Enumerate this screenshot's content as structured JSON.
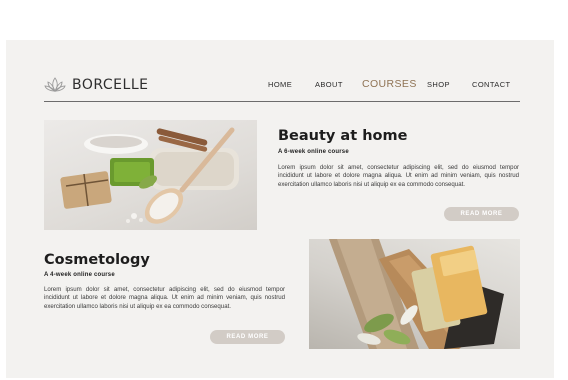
{
  "brand": {
    "name": "BORCELLE",
    "icon": "lotus-icon"
  },
  "nav": {
    "items": [
      {
        "label": "HOME",
        "active": false
      },
      {
        "label": "ABOUT",
        "active": false
      },
      {
        "label": "COURSES",
        "active": true
      },
      {
        "label": "SHOP",
        "active": false
      },
      {
        "label": "CONTACT",
        "active": false
      }
    ]
  },
  "colors": {
    "accent": "#8f7354",
    "button": "#d2ccc6",
    "background": "#f3f2f0",
    "text": "#1d1d1d"
  },
  "courses": [
    {
      "title": "Beauty at home",
      "subtitle": "A 6-week online course",
      "body": "Lorem ipsum dolor sit amet, consectetur adipiscing elit, sed do eiusmod tempor incididunt ut labore et dolore magna aliqua. Ut enim ad minim veniam, quis nostrud exercitation ullamco laboris nisi ut aliquip ex ea commodo consequat.",
      "button": "READ MORE",
      "image": "spa-soap-towel-photo"
    },
    {
      "title": "Cosmetology",
      "subtitle": "A 4-week online course",
      "body": "Lorem ipsum dolor sit amet, consectetur adipiscing elit, sed do eiusmod tempor incididunt ut labore et dolore magna aliqua. Ut enim ad minim veniam, quis nostrud exercitation ullamco laboris nisi ut aliquip ex ea commodo consequat.",
      "button": "READ MORE",
      "image": "soap-bars-plants-photo"
    }
  ]
}
